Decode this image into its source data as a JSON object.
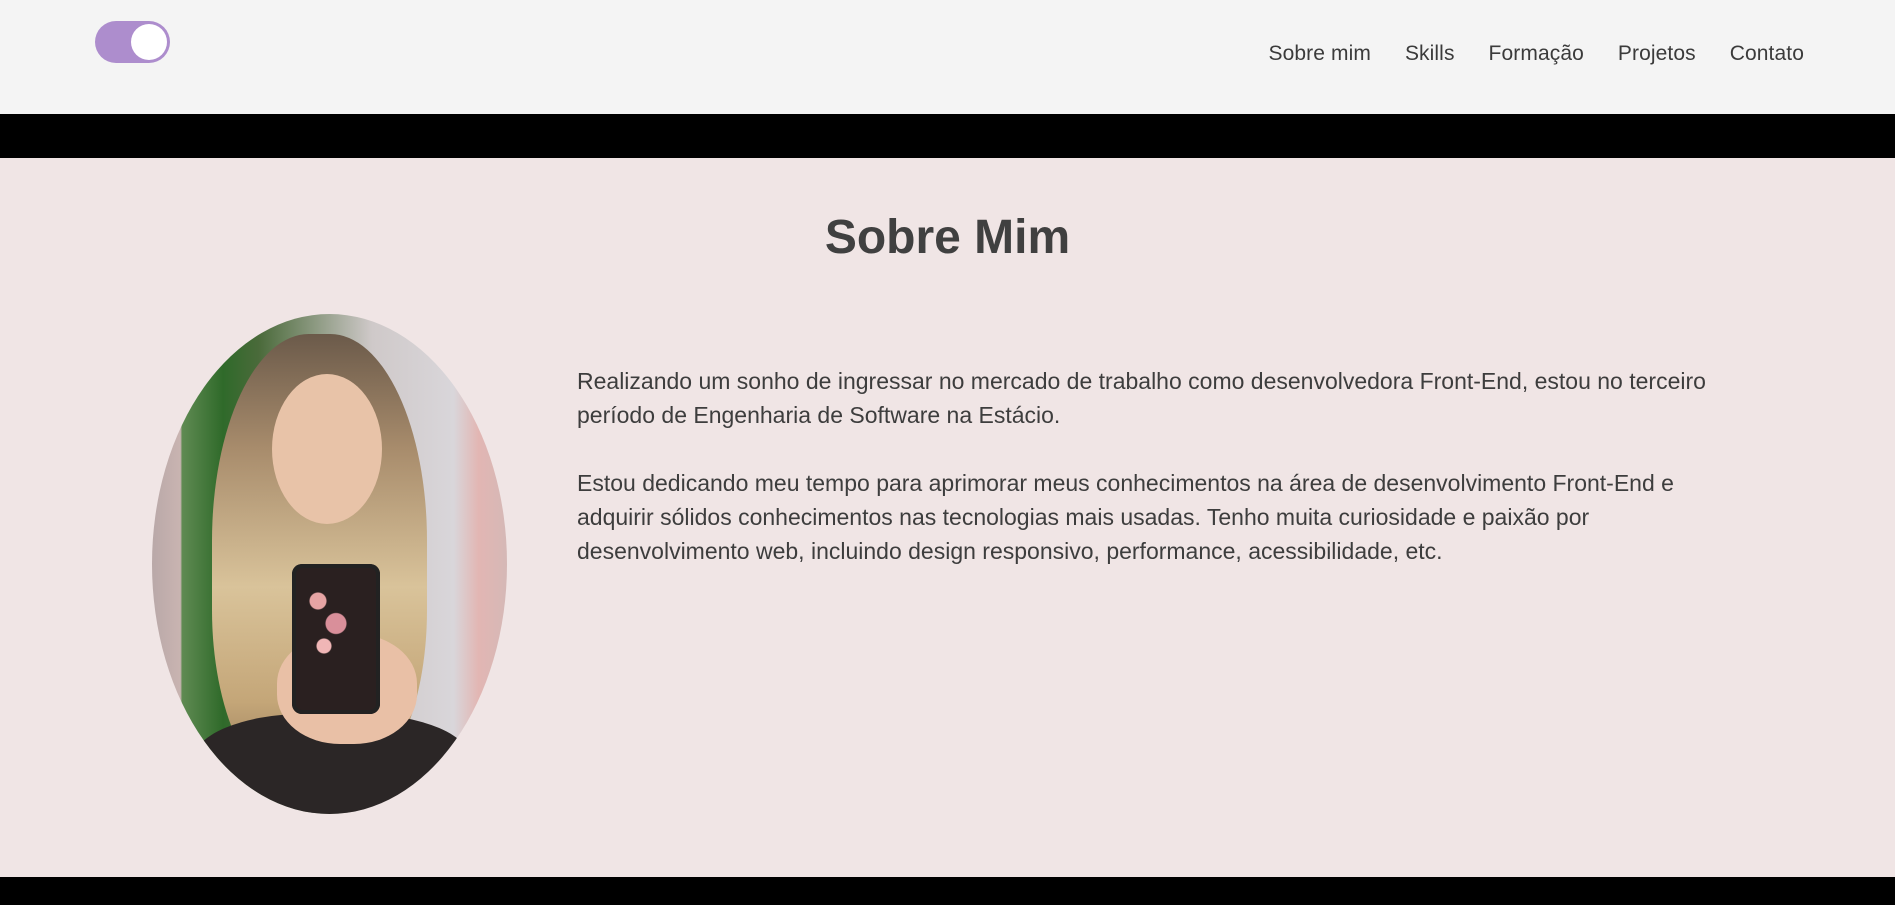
{
  "nav": {
    "items": [
      "Sobre mim",
      "Skills",
      "Formação",
      "Projetos",
      "Contato"
    ]
  },
  "about": {
    "title": "Sobre Mim",
    "paragraph1": "Realizando um sonho de ingressar no mercado de trabalho como desenvolvedora Front-End, estou no terceiro período de Engenharia de Software na Estácio.",
    "paragraph2": "Estou dedicando meu tempo para aprimorar meus conhecimentos na área de desenvolvimento Front-End e adquirir sólidos conhecimentos nas tecnologias mais usadas. Tenho muita curiosidade e paixão por desenvolvimento web, incluindo design responsivo, performance, acessibilidade, etc."
  },
  "colors": {
    "toggle": "#ad8dcd",
    "header_bg": "#f4f4f4",
    "section_bg": "#f0e5e5",
    "band": "#000000"
  },
  "icons": {
    "theme_toggle": "toggle-switch-icon"
  }
}
